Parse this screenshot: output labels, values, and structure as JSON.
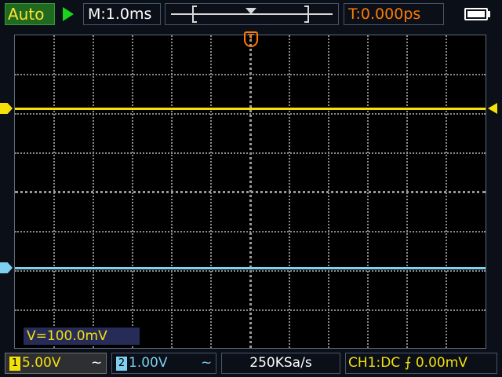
{
  "header": {
    "acquire_mode": "Auto",
    "timebase": "M:1.0ms",
    "trigger_time": "T:0.000ps",
    "run_state_icon": "play-triangle-icon",
    "battery_icon": "battery-icon"
  },
  "screen": {
    "trigger_position_marker": "T",
    "cursor_readout": "V=100.0mV"
  },
  "channels": [
    {
      "number": "1",
      "volts_div": "5.00V",
      "coupling": "~",
      "color": "#f5e10a"
    },
    {
      "number": "2",
      "volts_div": "1.00V",
      "coupling": "~",
      "color": "#7ed0f0"
    }
  ],
  "footer": {
    "sample_rate": "250KSa/s",
    "trigger_source": "CH1:DC",
    "trigger_edge_symbol": "⨍",
    "trigger_level": "0.00mV",
    "trigger_color": "#f5e10a"
  }
}
